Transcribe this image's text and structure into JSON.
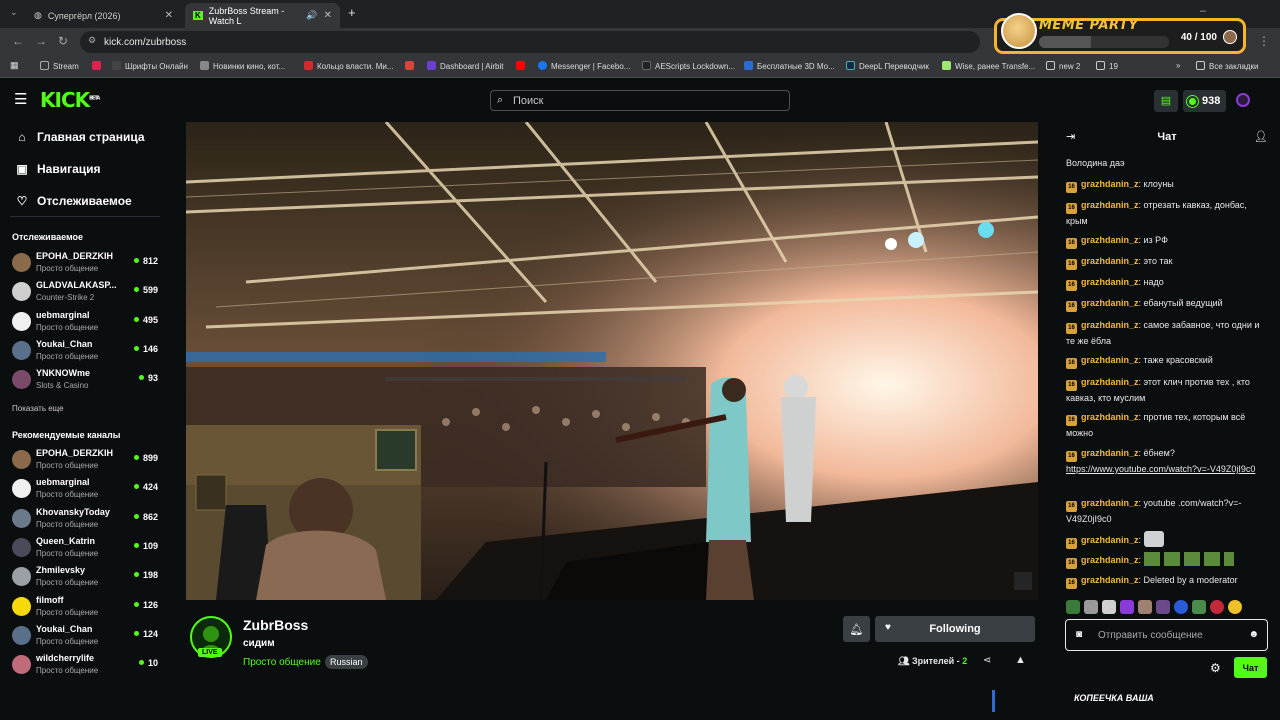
{
  "browser": {
    "tabs": [
      {
        "title": "Супергёрл (2026)"
      },
      {
        "title": "ZubrBoss Stream - Watch L"
      }
    ],
    "url": "kick.com/zubrboss",
    "bookmarks": [
      {
        "label": "Stream",
        "color": "#8a8a8a"
      },
      {
        "label": "",
        "color": "#e0224f"
      },
      {
        "label": "Шрифты Онлайн",
        "color": "#444"
      },
      {
        "label": "Новинки кино, кот...",
        "color": "#888"
      },
      {
        "label": "Кольцо власти. Ми...",
        "color": "#d02a2a"
      },
      {
        "label": "",
        "color": "#d44638"
      },
      {
        "label": "Dashboard | Airbit",
        "color": "#6b3fd1"
      },
      {
        "label": "",
        "color": "#ff0000"
      },
      {
        "label": "Messenger | Facebo...",
        "color": "#1877f2"
      },
      {
        "label": "AEScripts Lockdown...",
        "color": "#222"
      },
      {
        "label": "Бесплатные 3D Мо...",
        "color": "#2a6bd6"
      },
      {
        "label": "DeepL Переводчик",
        "color": "#0f2b46"
      },
      {
        "label": "Wise, ранее Transfe...",
        "color": "#9fe870"
      },
      {
        "label": "new 2",
        "color": "#8a8a8a"
      },
      {
        "label": "19",
        "color": "#8a8a8a"
      },
      {
        "label": "Все закладки",
        "color": "#8a8a8a"
      }
    ]
  },
  "meme_party": {
    "title": "MEME PARTY",
    "count": "40 / 100",
    "progress": 0.4
  },
  "header": {
    "logo": "KICK",
    "logo_tag": "BETA",
    "search_placeholder": "Поиск",
    "coins": "938"
  },
  "sidebar": {
    "nav": [
      {
        "label": "Главная страница",
        "icon": "home-icon"
      },
      {
        "label": "Навигация",
        "icon": "compass-icon"
      },
      {
        "label": "Отслеживаемое",
        "icon": "heart-icon"
      }
    ],
    "following_title": "Отслеживаемое",
    "following": [
      {
        "name": "EPOHA_DERZKIH",
        "category": "Просто общение",
        "viewers": "812",
        "color": "#8a6a4a"
      },
      {
        "name": "GLADVALAKASP...",
        "category": "Counter-Strike 2",
        "viewers": "599",
        "color": "#cfcfcf"
      },
      {
        "name": "uebmarginal",
        "category": "Просто общение",
        "viewers": "495",
        "color": "#f0f0f0"
      },
      {
        "name": "Youkai_Chan",
        "category": "Просто общение",
        "viewers": "146",
        "color": "#5a6f8a"
      },
      {
        "name": "YNKNOWme",
        "category": "Slots & Casino",
        "viewers": "93",
        "color": "#7a4a6a"
      }
    ],
    "show_more": "Показать еще",
    "recommended_title": "Рекомендуемые каналы",
    "recommended": [
      {
        "name": "EPOHA_DERZKIH",
        "category": "Просто общение",
        "viewers": "899",
        "color": "#8a6a4a"
      },
      {
        "name": "uebmarginal",
        "category": "Просто общение",
        "viewers": "424",
        "color": "#f0f0f0"
      },
      {
        "name": "KhovanskyToday",
        "category": "Просто общение",
        "viewers": "862",
        "color": "#6a7a8a"
      },
      {
        "name": "Queen_Katrin",
        "category": "Просто общение",
        "viewers": "109",
        "color": "#4a4a5a"
      },
      {
        "name": "Zhmilevsky",
        "category": "Просто общение",
        "viewers": "198",
        "color": "#9aa0a6"
      },
      {
        "name": "filmoff",
        "category": "Просто общение",
        "viewers": "126",
        "color": "#f5d90a"
      },
      {
        "name": "Youkai_Chan",
        "category": "Просто общение",
        "viewers": "124",
        "color": "#5a6f8a"
      },
      {
        "name": "wildcherrylife",
        "category": "Просто общение",
        "viewers": "10",
        "color": "#c06a7a"
      }
    ]
  },
  "stream": {
    "channel": "ZubrBoss",
    "live": "LIVE",
    "title": "сидим",
    "category": "Просто общение",
    "language": "Russian",
    "follow_label": "Following",
    "viewers_label": "Зрителей -",
    "viewers_count": "2"
  },
  "chat": {
    "title": "Чат",
    "messages": [
      {
        "badge": "",
        "user": "",
        "text": "Володина даэ"
      },
      {
        "badge": "16",
        "user": "grazhdanin_z",
        "text": "клоуны"
      },
      {
        "badge": "16",
        "user": "grazhdanin_z",
        "text": "отрезать кавказ, донбас, крым"
      },
      {
        "badge": "16",
        "user": "grazhdanin_z",
        "text": "из РФ"
      },
      {
        "badge": "16",
        "user": "grazhdanin_z",
        "text": "это так"
      },
      {
        "badge": "16",
        "user": "grazhdanin_z",
        "text": "надо"
      },
      {
        "badge": "16",
        "user": "grazhdanin_z",
        "text": "ебанутый ведущий"
      },
      {
        "badge": "16",
        "user": "grazhdanin_z",
        "text": "самое забавное, что одни и те же ёбла"
      },
      {
        "badge": "16",
        "user": "grazhdanin_z",
        "text": "таже красовский"
      },
      {
        "badge": "16",
        "user": "grazhdanin_z",
        "text": "этот клич против тех , кто кавказ, кто муслим"
      },
      {
        "badge": "16",
        "user": "grazhdanin_z",
        "text": "против тех, которым всё можно"
      },
      {
        "badge": "16",
        "user": "grazhdanin_z",
        "text": "ёбнем?",
        "link": "https://www.youtube.com/watch?v=-V49Z0jI9c0"
      },
      {
        "badge": "16",
        "user": "grazhdanin_z",
        "text": "youtube .com/watch?v=-V49Z0jI9c0"
      },
      {
        "badge": "16",
        "user": "grazhdanin_z",
        "text": ""
      },
      {
        "badge": "16",
        "user": "grazhdanin_z",
        "text": ""
      },
      {
        "badge": "16",
        "user": "grazhdanin_z",
        "text": "Deleted by a moderator"
      }
    ],
    "input_placeholder": "Отправить сообщение",
    "send_label": "Чат"
  },
  "overlay_text": "КОПЕЕЧКА ВАША"
}
